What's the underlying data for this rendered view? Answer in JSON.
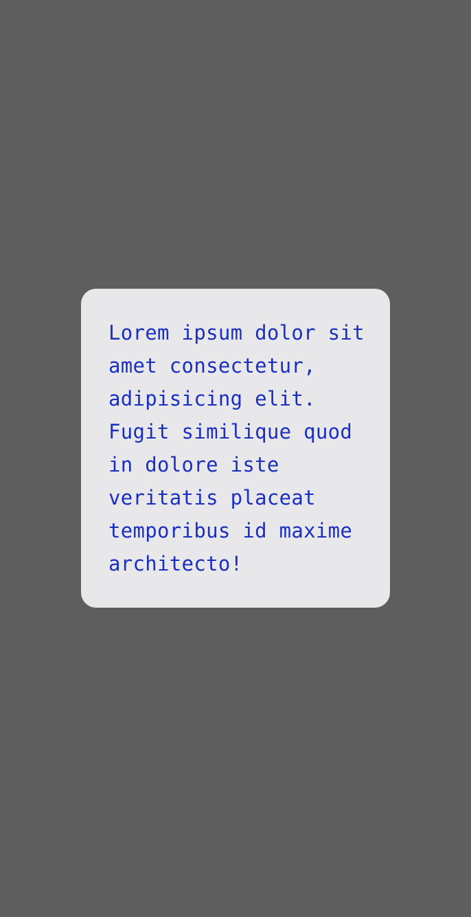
{
  "colors": {
    "background": "#5e5e5e",
    "card_background": "#e8e7ea",
    "text": "#1a2fbf"
  },
  "card": {
    "text": "Lorem ipsum dolor sit amet consectetur, adipisicing elit. Fugit similique quod in dolore iste veritatis placeat temporibus id maxime architecto!"
  }
}
